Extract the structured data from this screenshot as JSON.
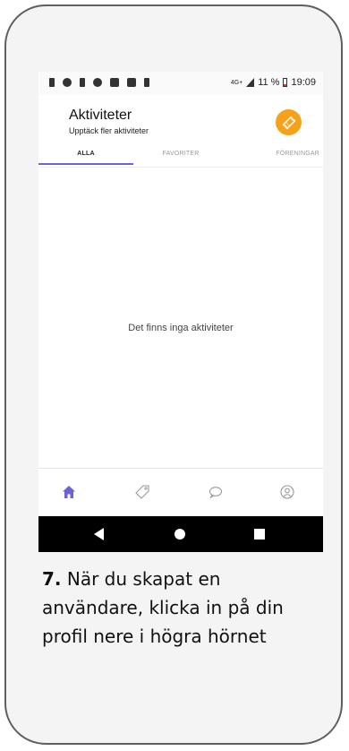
{
  "status_bar": {
    "network": "4G+",
    "battery": "11 %",
    "time": "19:09"
  },
  "header": {
    "title": "Aktiviteter",
    "subtitle": "Upptäck fler aktiviteter",
    "action_icon": "ticket-icon"
  },
  "tabs": [
    {
      "label": "ALLA",
      "active": true
    },
    {
      "label": "FAVORITER",
      "active": false
    },
    {
      "label": "FÖRENINGAR",
      "active": false
    }
  ],
  "empty_state": "Det finns inga aktiviteter",
  "bottom_nav": [
    {
      "icon": "home-icon",
      "active": true
    },
    {
      "icon": "tag-icon",
      "active": false
    },
    {
      "icon": "chat-icon",
      "active": false
    },
    {
      "icon": "profile-icon",
      "active": false
    }
  ],
  "caption": {
    "step": "7.",
    "text": " När du skapat en användare, klicka in på din profil nere i högra hörnet"
  },
  "colors": {
    "accent": "#6b63d6",
    "ticket": "#f5a21a",
    "frame": "#5f5f5f"
  }
}
